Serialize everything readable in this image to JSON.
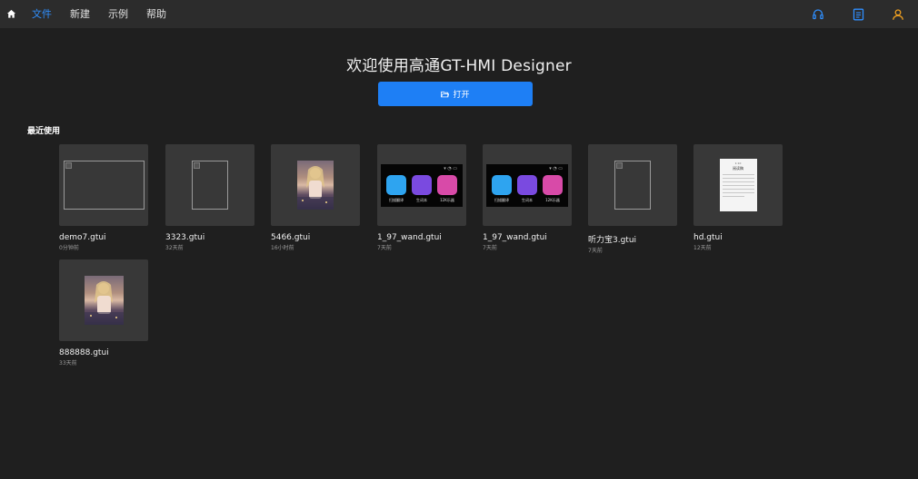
{
  "menu": {
    "home_icon": "home-icon",
    "items": [
      "文件",
      "新建",
      "示例",
      "帮助"
    ],
    "active_index": 0
  },
  "top_right": {
    "icons": [
      "headset-icon",
      "document-icon",
      "user-icon"
    ],
    "colors": [
      "#2f8fff",
      "#2f8fff",
      "#f0a020"
    ]
  },
  "welcome": {
    "title": "欢迎使用高通GT-HMI Designer",
    "open_label": "打开"
  },
  "recent": {
    "title": "最近使用",
    "files": [
      {
        "name": "demo7.gtui",
        "time": "0分钟前",
        "thumb": "broken-wide"
      },
      {
        "name": "3323.gtui",
        "time": "32天前",
        "thumb": "broken-square"
      },
      {
        "name": "5466.gtui",
        "time": "16小时前",
        "thumb": "photo"
      },
      {
        "name": "1_97_wand.gtui",
        "time": "7天前",
        "thumb": "apps"
      },
      {
        "name": "1_97_wand.gtui",
        "time": "7天前",
        "thumb": "apps"
      },
      {
        "name": "听力宝3.gtui",
        "time": "7天前",
        "thumb": "broken-square"
      },
      {
        "name": "hd.gtui",
        "time": "12天前",
        "thumb": "document"
      },
      {
        "name": "888888.gtui",
        "time": "33天前",
        "thumb": "photo"
      }
    ]
  },
  "app_thumb": {
    "labels": [
      "扫描翻译",
      "生词本",
      "12K乐器"
    ],
    "colors": [
      "#2ea4f0",
      "#7a4ae0",
      "#d84aa8"
    ]
  },
  "doc_thumb": {
    "heading": "1:10",
    "title": "阅读稿"
  }
}
